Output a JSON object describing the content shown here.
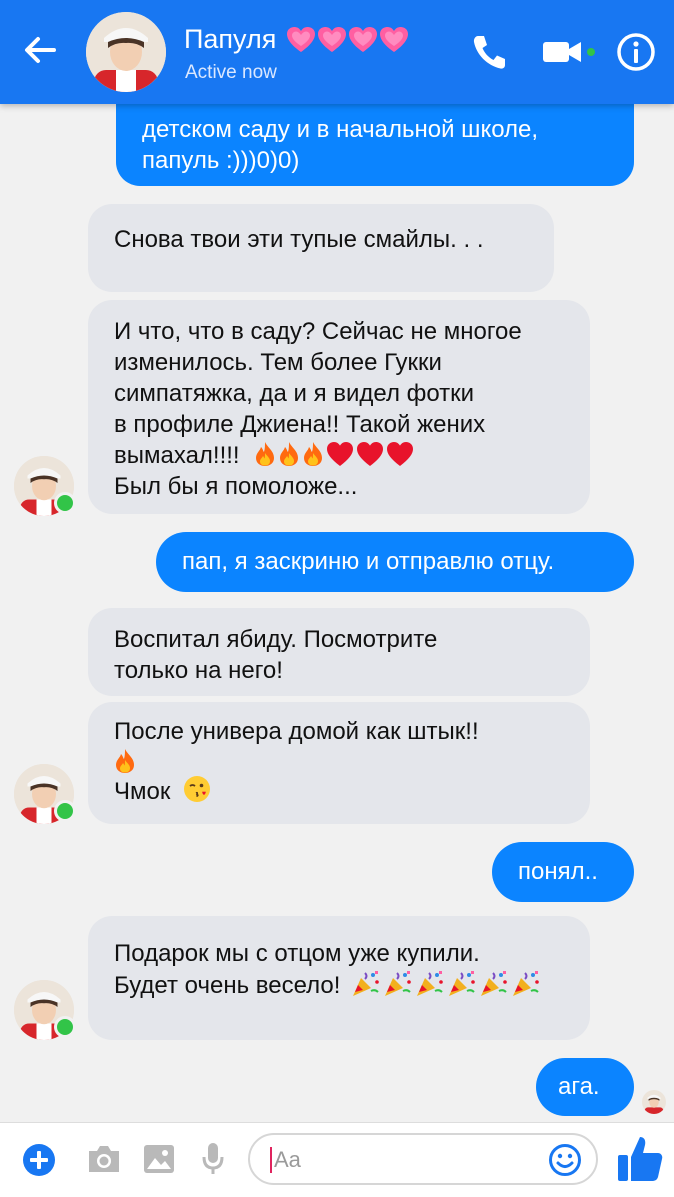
{
  "contact": {
    "name": "Папуля",
    "status": "Active now"
  },
  "colors": {
    "brand": "#1877f2",
    "outgoing": "#0b84ff",
    "incoming": "#e4e6eb",
    "online": "#32c448"
  },
  "messages": [
    {
      "direction": "outgoing",
      "lines": [
        "детском саду и в начальной школе,",
        "папуль :)))0)0)"
      ]
    },
    {
      "direction": "incoming",
      "lines": [
        "Снова твои эти тупые смайлы. . ."
      ]
    },
    {
      "direction": "incoming",
      "lines": [
        "И что, что в саду? Сейчас не многое",
        "изменилось. Тем более Гукки",
        "симпатяжка, да и я видел фотки",
        "в профиле Джиена!! Такой жених",
        "вымахал!!!!",
        "Был бы я помоложе..."
      ],
      "emojis": [
        "fire-icon",
        "fire-icon",
        "fire-icon",
        "heart-icon",
        "heart-icon",
        "heart-icon"
      ]
    },
    {
      "direction": "outgoing",
      "lines": [
        "пап, я заскриню и отправлю отцу."
      ]
    },
    {
      "direction": "incoming",
      "lines": [
        "Воспитал ябиду. Посмотрите",
        "только на него!"
      ]
    },
    {
      "direction": "incoming",
      "lines": [
        "После универа домой как штык!!",
        "Чмок"
      ],
      "emojis": [
        "fire-icon",
        "kiss-face-icon"
      ]
    },
    {
      "direction": "outgoing",
      "lines": [
        "понял.."
      ]
    },
    {
      "direction": "incoming",
      "lines": [
        "Подарок мы с отцом уже купили.",
        "Будет очень весело!"
      ],
      "emojis": [
        "party-popper-icon",
        "party-popper-icon",
        "party-popper-icon",
        "party-popper-icon",
        "party-popper-icon",
        "party-popper-icon"
      ]
    },
    {
      "direction": "outgoing",
      "lines": [
        "ага."
      ]
    }
  ],
  "composer": {
    "placeholder": "Aa"
  }
}
